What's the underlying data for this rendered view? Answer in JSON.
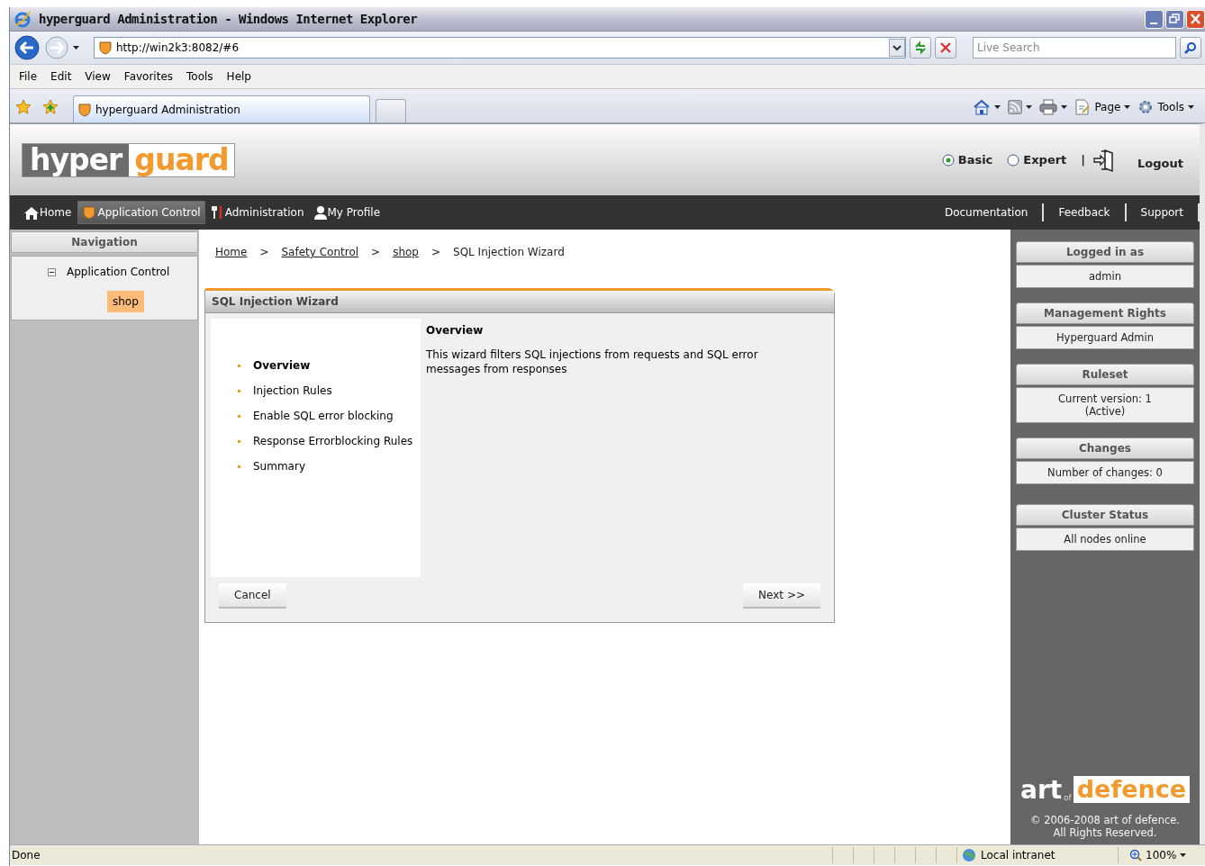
{
  "window": {
    "title": "hyperguard Administration - Windows Internet Explorer"
  },
  "browser": {
    "address": "http://win2k3:8082/#6",
    "search_placeholder": "Live Search",
    "menu": [
      "File",
      "Edit",
      "View",
      "Favorites",
      "Tools",
      "Help"
    ],
    "tab": "hyperguard Administration",
    "commands": [
      {
        "kind": "home"
      },
      {
        "kind": "feeds"
      },
      {
        "kind": "print"
      },
      {
        "kind": "page",
        "label": "Page"
      },
      {
        "kind": "tools",
        "label": "Tools"
      }
    ]
  },
  "app": {
    "logo": [
      "hyper",
      "guard"
    ],
    "modes": [
      {
        "label": "Basic",
        "selected": true
      },
      {
        "label": "Expert",
        "selected": false
      }
    ],
    "divider": "|",
    "logout": "Logout",
    "nav": [
      {
        "kind": "home",
        "label": "Home",
        "selected": false
      },
      {
        "kind": "shield",
        "label": "Application Control",
        "selected": true
      },
      {
        "kind": "tools",
        "label": "Administration",
        "selected": false
      },
      {
        "kind": "person",
        "label": "My Profile",
        "selected": false
      }
    ],
    "links": [
      "Documentation",
      "Feedback",
      "Support"
    ]
  },
  "navigation": {
    "title": "Navigation",
    "tree": [
      {
        "label": "Application Control",
        "expanded": true,
        "children": [
          {
            "label": "shop",
            "selected": true
          }
        ]
      }
    ]
  },
  "breadcrumb": [
    {
      "kind": "link",
      "text": "Home"
    },
    {
      "kind": "sep",
      "text": ">"
    },
    {
      "kind": "link",
      "text": "Safety Control"
    },
    {
      "kind": "sep",
      "text": ">"
    },
    {
      "kind": "link",
      "text": "shop"
    },
    {
      "kind": "sep",
      "text": ">"
    },
    {
      "kind": "current",
      "text": "SQL Injection Wizard"
    }
  ],
  "wizard": {
    "title": "SQL Injection Wizard",
    "steps": [
      {
        "label": "Overview",
        "selected": true
      },
      {
        "label": "Injection Rules",
        "selected": false
      },
      {
        "label": "Enable SQL error blocking",
        "selected": false
      },
      {
        "label": "Response Errorblocking Rules",
        "selected": false
      },
      {
        "label": "Summary",
        "selected": false
      }
    ],
    "heading": "Overview",
    "description": "This wizard filters SQL injections from requests and SQL error messages from responses",
    "cancel": "Cancel",
    "next": "Next >>"
  },
  "info_panels": [
    {
      "title": "Logged in as",
      "lines": [
        "admin"
      ]
    },
    {
      "title": "Management Rights",
      "lines": [
        "Hyperguard Admin"
      ]
    },
    {
      "title": "Ruleset",
      "lines": [
        "Current version: 1",
        "(Active)"
      ]
    },
    {
      "title": "Changes",
      "lines": [
        "Number of changes: 0"
      ]
    },
    {
      "title": "Cluster Status",
      "lines": [
        "All nodes online"
      ]
    }
  ],
  "footer": {
    "logo": [
      "art",
      "of",
      "defence"
    ],
    "copyright": [
      "© 2006-2008 art of defence.",
      "All Rights Reserved."
    ]
  },
  "status_bar": {
    "text": "Done",
    "zone": "Local intranet",
    "zoom": "100%"
  }
}
